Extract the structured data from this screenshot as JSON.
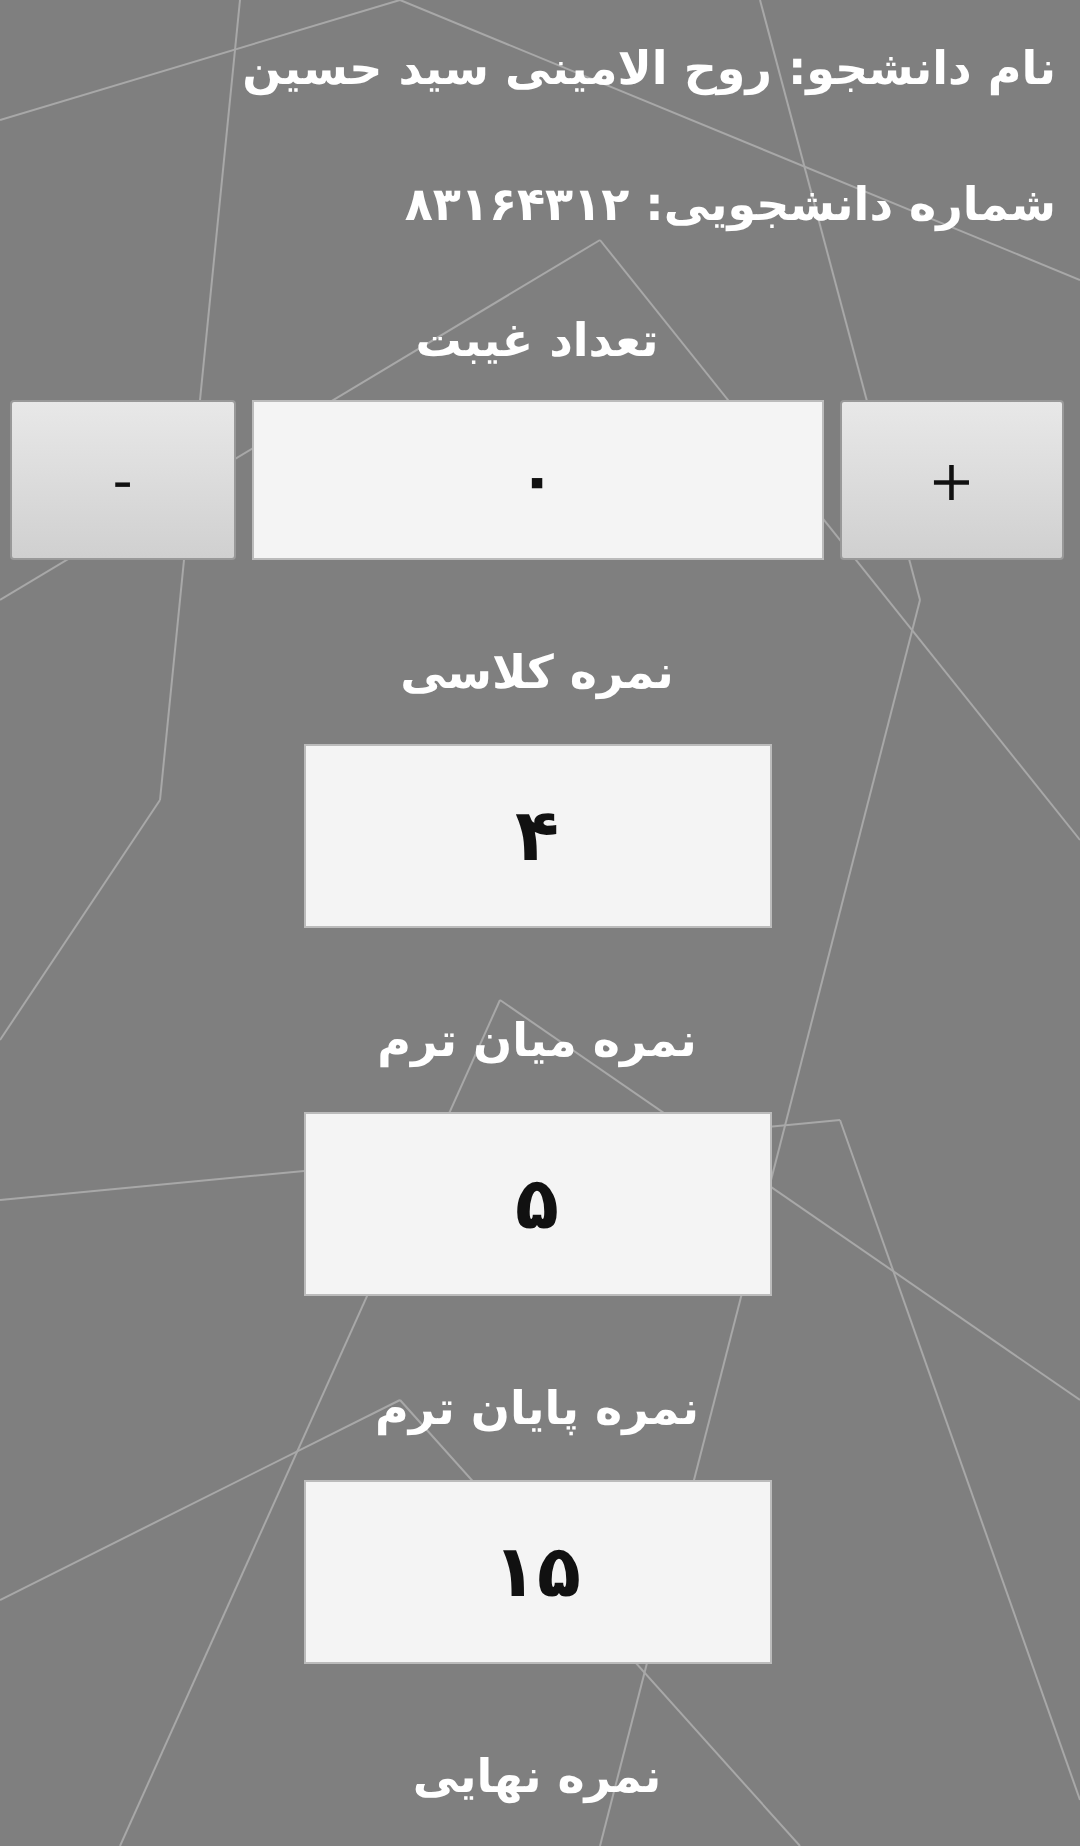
{
  "student_name": {
    "label": "نام دانشجو:",
    "value": "روح الامینی سید حسین"
  },
  "student_id": {
    "label": "شماره دانشجویی:",
    "value": "۸۳۱۶۴۳۱۲"
  },
  "absences": {
    "label": "تعداد غیبت",
    "decrement": "-",
    "value": "۰",
    "increment": "+"
  },
  "grades": [
    {
      "label": "نمره کلاسی",
      "value": "۴"
    },
    {
      "label": "نمره میان ترم",
      "value": "۵"
    },
    {
      "label": "نمره پایان ترم",
      "value": "۱۵"
    }
  ],
  "final_grade": {
    "label": "نمره نهایی"
  }
}
